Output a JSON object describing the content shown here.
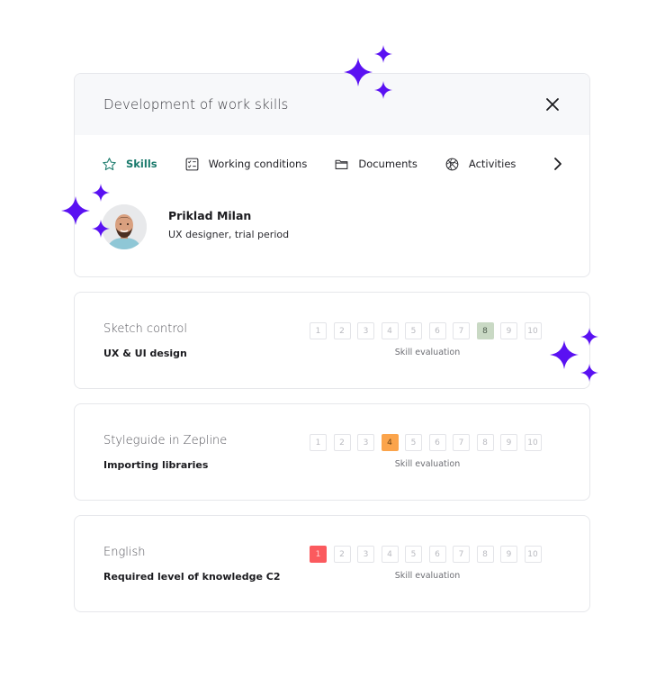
{
  "dialog": {
    "title": "Development of work skills",
    "close_icon": "close-icon"
  },
  "tabs": [
    {
      "label": "Skills",
      "icon": "star-icon",
      "active": true
    },
    {
      "label": "Working conditions",
      "icon": "checklist-icon",
      "active": false
    },
    {
      "label": "Documents",
      "icon": "folder-icon",
      "active": false
    },
    {
      "label": "Activities",
      "icon": "basketball-icon",
      "active": false
    }
  ],
  "tabs_next_icon": "chevron-right-icon",
  "profile": {
    "name": "Priklad Milan",
    "role": "UX designer, trial period"
  },
  "skills": [
    {
      "title": "Sketch control",
      "subtitle": "UX & UI design",
      "scale_label": "Skill evaluation",
      "value": 8,
      "max": 10,
      "color": "#c9d9c4",
      "text_color": "#4c5b4c"
    },
    {
      "title": "Styleguide in Zepline",
      "subtitle": "Importing libraries",
      "scale_label": "Skill evaluation",
      "value": 4,
      "max": 10,
      "color": "#fba44b",
      "text_color": "#6b4216"
    },
    {
      "title": "English",
      "subtitle": "Required level of knowledge C2",
      "scale_label": "Skill evaluation",
      "value": 1,
      "max": 10,
      "color": "#fb5a5e",
      "text_color": "#ffd2d3"
    }
  ],
  "colors": {
    "accent": "#1a7a6c",
    "sparkle": "#5a11f2"
  }
}
